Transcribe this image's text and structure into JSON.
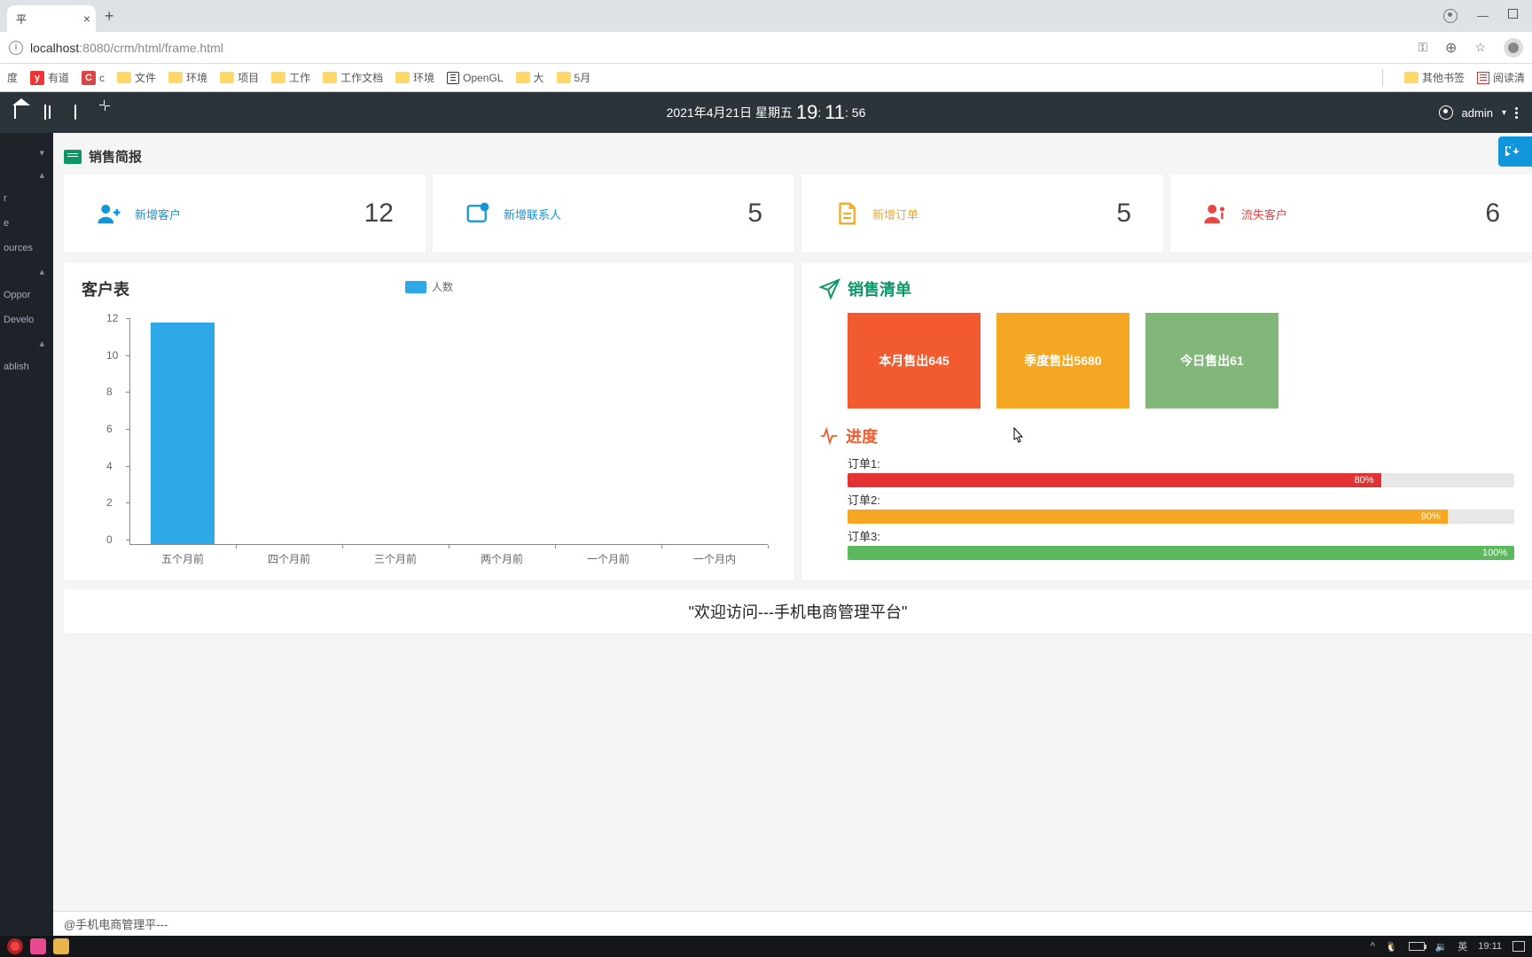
{
  "browser": {
    "tab_title": "平",
    "url_host": "localhost",
    "url_port": ":8080",
    "url_path": "/crm/html/frame.html"
  },
  "bookmarks": {
    "b0": "度",
    "b1": "有道",
    "b2": "c",
    "b3": "文件",
    "b4": "环境",
    "b5": "项目",
    "b6": "工作",
    "b7": "工作文档",
    "b8": "环境",
    "b9": "OpenGL",
    "b10": "大",
    "b11": "5月",
    "other": "其他书签",
    "read": "阅读清"
  },
  "appbar": {
    "datetime_pre": "2021年4月21日 星期五 ",
    "hh": "19",
    "mm": "11",
    "ss": "56",
    "user": "admin"
  },
  "sidebar": {
    "i0": "r",
    "i1": "e",
    "i2": "ources",
    "i3": "Oppor",
    "i4": "Develo",
    "i5": "ablish"
  },
  "section": {
    "title": "销售简报"
  },
  "stats": {
    "s1": {
      "label": "新增客户",
      "value": "12"
    },
    "s2": {
      "label": "新增联系人",
      "value": "5"
    },
    "s3": {
      "label": "新增订单",
      "value": "5"
    },
    "s4": {
      "label": "流失客户",
      "value": "6"
    }
  },
  "chart": {
    "title": "客户表",
    "legend": "人数"
  },
  "chart_data": {
    "type": "bar",
    "title": "客户表",
    "legend": [
      "人数"
    ],
    "categories": [
      "五个月前",
      "四个月前",
      "三个月前",
      "两个月前",
      "一个月前",
      "一个月内"
    ],
    "values": [
      12,
      0,
      0,
      0,
      0,
      0
    ],
    "ylim": [
      0,
      12
    ],
    "yticks": [
      0,
      2,
      4,
      6,
      8,
      10,
      12
    ]
  },
  "sales": {
    "title": "销售清单",
    "b1": "本月售出645",
    "b2": "季度售出5680",
    "b3": "今日售出61"
  },
  "progress": {
    "title": "进度",
    "p1": {
      "label": "订单1:",
      "pct": 80,
      "text": "80%"
    },
    "p2": {
      "label": "订单2:",
      "pct": 90,
      "text": "90%"
    },
    "p3": {
      "label": "订单3:",
      "pct": 100,
      "text": "100%"
    }
  },
  "marquee": "\"欢迎访问---手机电商管理平台\"",
  "footer": "@手机电商管理平---",
  "taskbar": {
    "ime": "英",
    "time": "19:11"
  }
}
